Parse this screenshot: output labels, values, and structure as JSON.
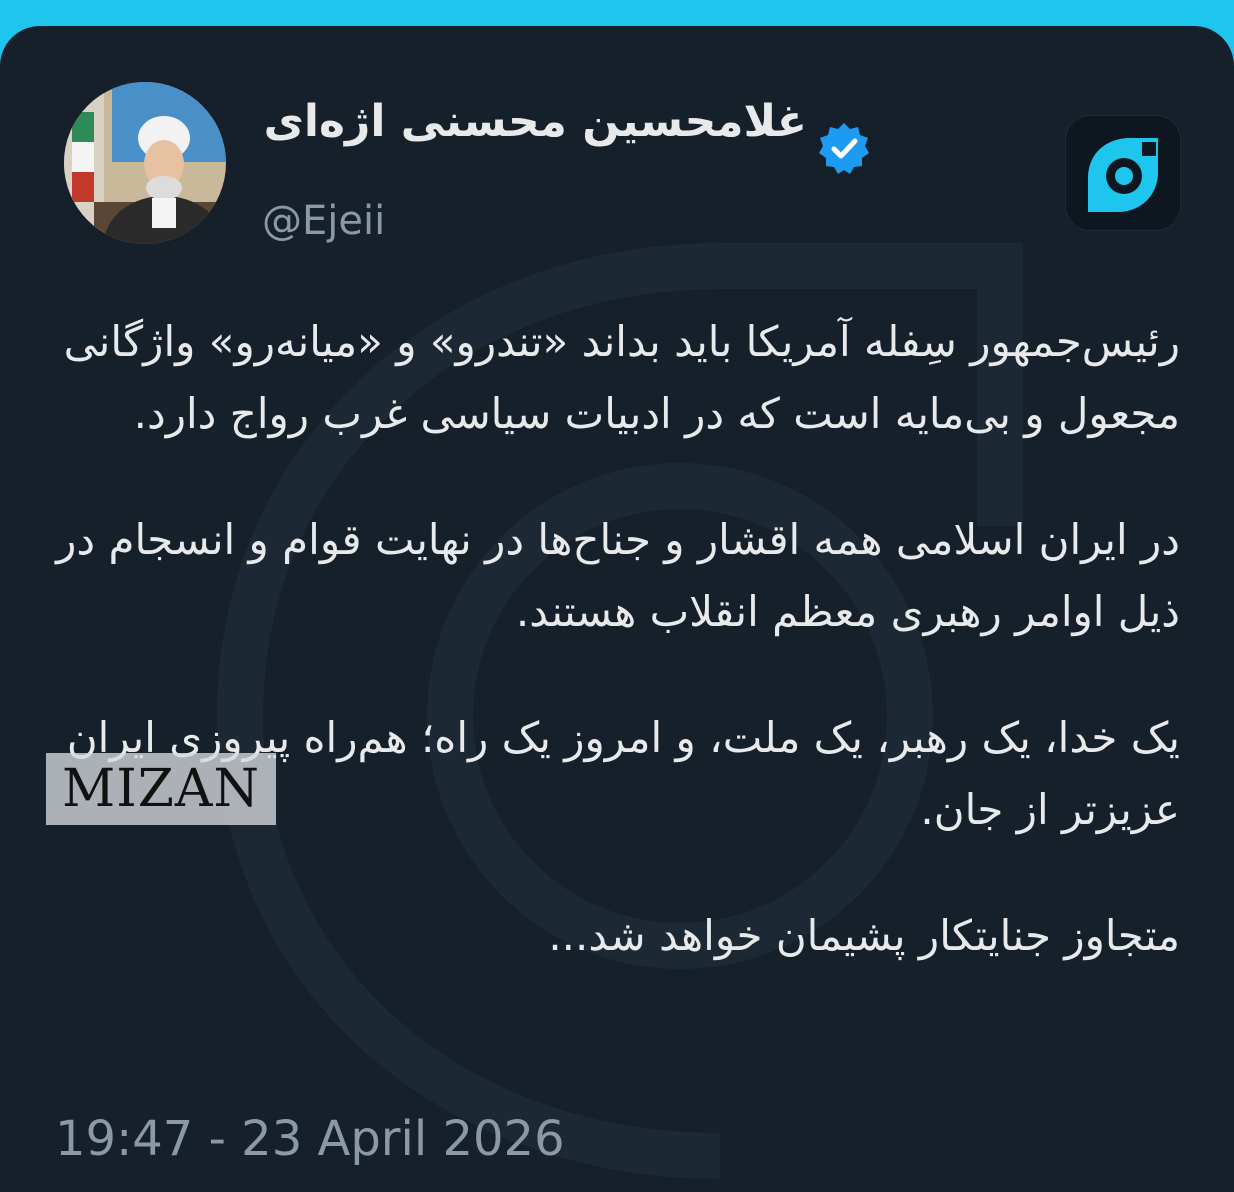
{
  "author": {
    "display_name": "غلامحسین محسنی اژه‌ای",
    "handle": "@Ejeii",
    "verified": true
  },
  "tweet": {
    "paragraphs": [
      "رئیس‌جمهور سِفله آمریکا باید بداند «تندرو» و «میانه‌رو» واژگانی مجعول و بی‌مایه است که در ادبیات سیاسی غرب رواج دارد.",
      "در ایران اسلامی همه اقشار و جناح‌ها در نهایت قوام و انسجام در ذیل اوامر رهبری معظم انقلاب هستند.",
      "یک خدا، یک رهبر، یک ملت، و امروز یک راه؛ هم‌راه پیروزی ایران عزیزتر از جان.",
      "متجاوز جنایتکار پشیمان خواهد شد..."
    ],
    "timestamp": "19:47 - 23 April 2026"
  },
  "watermark": {
    "text": "MIZAN"
  },
  "icons": {
    "verified": "verified-badge-icon",
    "app_logo": "app-logo-icon"
  },
  "colors": {
    "background": "#15202b",
    "frame": "#1ec6ee",
    "text": "#e7e9ea",
    "secondary_text": "#8b98a5",
    "verified": "#1d9bf0"
  }
}
